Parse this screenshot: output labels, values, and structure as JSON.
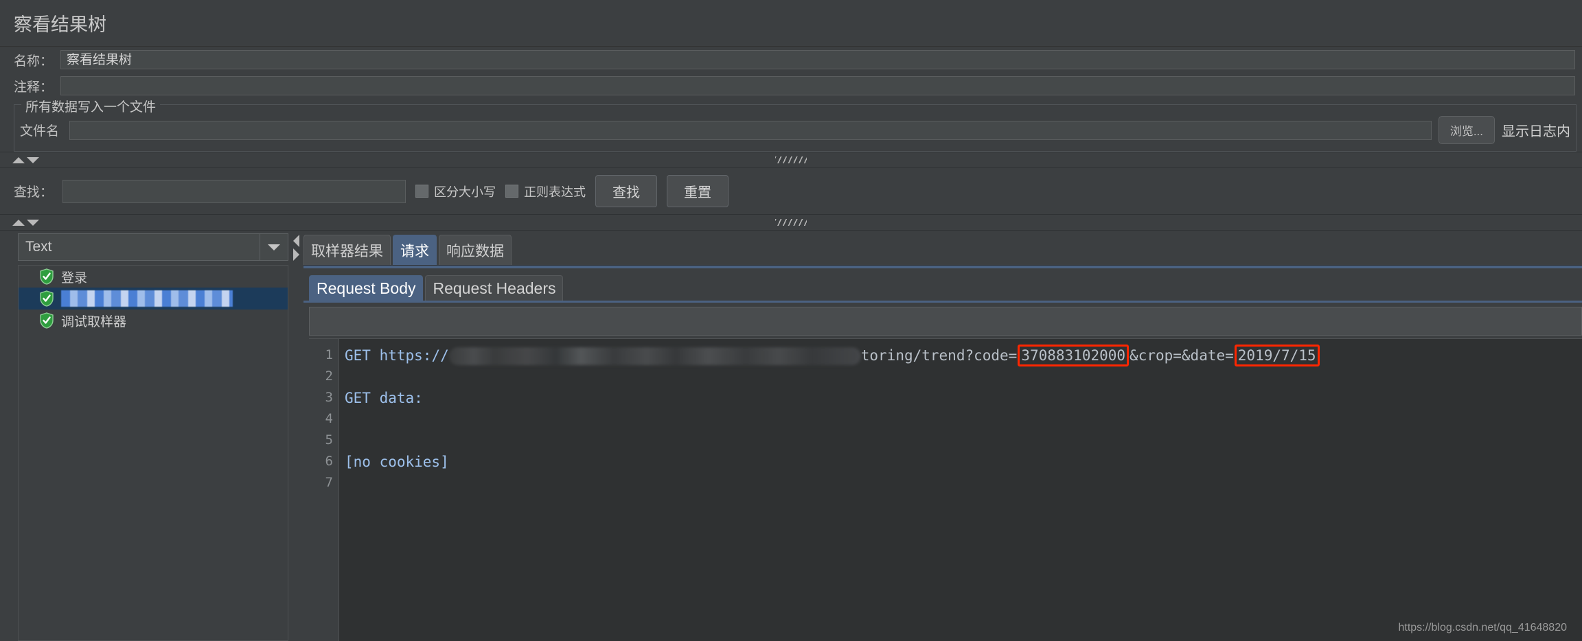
{
  "panel": {
    "title": "察看结果树"
  },
  "fields": {
    "name_label": "名称：",
    "name_value": "察看结果树",
    "comment_label": "注释：",
    "comment_value": ""
  },
  "file_group": {
    "title": "所有数据写入一个文件",
    "filename_label": "文件名",
    "filename_value": "",
    "browse_button": "浏览...",
    "log_content_label": "显示日志内"
  },
  "search": {
    "label": "查找：",
    "value": "",
    "case_sensitive_label": "区分大小写",
    "case_sensitive_checked": false,
    "regex_label": "正则表达式",
    "regex_checked": false,
    "find_button": "查找",
    "reset_button": "重置"
  },
  "left_pane": {
    "render_selector_value": "Text",
    "tree_items": [
      {
        "label": "登录",
        "status": "success",
        "selected": false,
        "redacted": false
      },
      {
        "label": "",
        "status": "success",
        "selected": true,
        "redacted": true
      },
      {
        "label": "调试取样器",
        "status": "success",
        "selected": false,
        "redacted": false
      }
    ]
  },
  "result_tabs": [
    {
      "label": "取样器结果",
      "active": false
    },
    {
      "label": "请求",
      "active": true
    },
    {
      "label": "响应数据",
      "active": false
    }
  ],
  "request_subtabs": [
    {
      "label": "Request Body",
      "active": true
    },
    {
      "label": "Request Headers",
      "active": false
    }
  ],
  "code": {
    "line_numbers": [
      "1",
      "2",
      "3",
      "4",
      "5",
      "6",
      "7"
    ],
    "line1_method": "GET",
    "line1_scheme": "https://",
    "line1_path": "toring/trend?code=",
    "line1_highlight_code": "370883102000",
    "line1_mid": "&crop=&date=",
    "line1_highlight_date": "2019/7/15",
    "line3": "GET data:",
    "line6": "[no cookies]",
    "highlight_color": "#ff2600"
  },
  "watermark": "https://blog.csdn.net/qq_41648820"
}
